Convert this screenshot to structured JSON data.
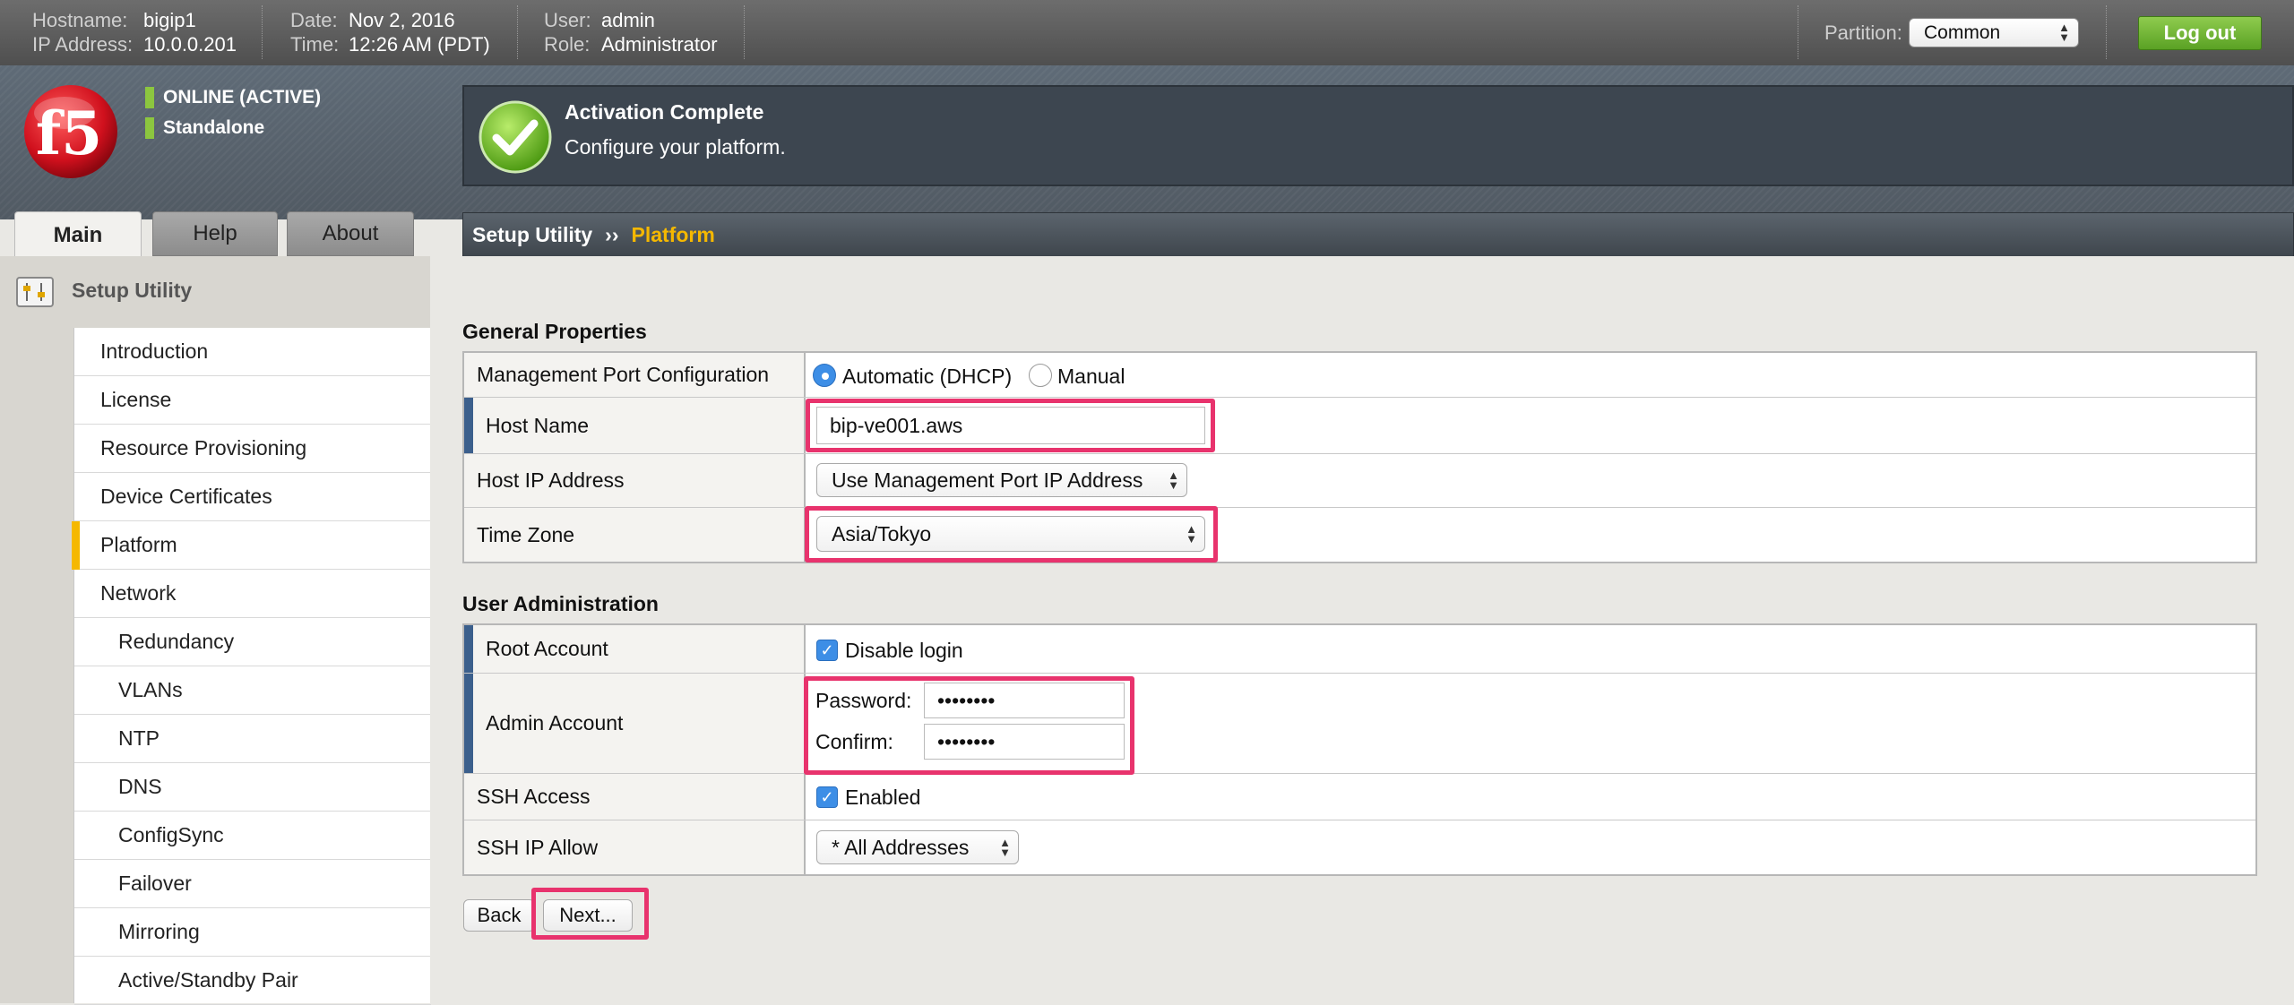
{
  "topbar": {
    "hostname_label": "Hostname:",
    "hostname": "bigip1",
    "ip_label": "IP Address:",
    "ip": "10.0.0.201",
    "date_label": "Date:",
    "date": "Nov 2, 2016",
    "time_label": "Time:",
    "time": "12:26 AM (PDT)",
    "user_label": "User:",
    "user": "admin",
    "role_label": "Role:",
    "role": "Administrator",
    "partition_label": "Partition:",
    "partition_value": "Common",
    "logout_label": "Log out"
  },
  "status": {
    "online": "ONLINE (ACTIVE)",
    "mode": "Standalone"
  },
  "activation": {
    "title": "Activation Complete",
    "subtitle": "Configure your platform."
  },
  "tabs": [
    {
      "label": "Main",
      "active": true
    },
    {
      "label": "Help",
      "active": false
    },
    {
      "label": "About",
      "active": false
    }
  ],
  "breadcrumb": {
    "root": "Setup Utility",
    "separator": "››",
    "current": "Platform"
  },
  "sidebar": {
    "title": "Setup Utility",
    "items": [
      {
        "label": "Introduction",
        "indent": false
      },
      {
        "label": "License",
        "indent": false
      },
      {
        "label": "Resource Provisioning",
        "indent": false
      },
      {
        "label": "Device Certificates",
        "indent": false
      },
      {
        "label": "Platform",
        "indent": false,
        "active": true
      },
      {
        "label": "Network",
        "indent": false
      },
      {
        "label": "Redundancy",
        "indent": true
      },
      {
        "label": "VLANs",
        "indent": true
      },
      {
        "label": "NTP",
        "indent": true
      },
      {
        "label": "DNS",
        "indent": true
      },
      {
        "label": "ConfigSync",
        "indent": true
      },
      {
        "label": "Failover",
        "indent": true
      },
      {
        "label": "Mirroring",
        "indent": true
      },
      {
        "label": "Active/Standby Pair",
        "indent": true
      }
    ]
  },
  "general": {
    "title": "General Properties",
    "mgmt_port_label": "Management Port Configuration",
    "mgmt_option_auto": "Automatic (DHCP)",
    "mgmt_option_manual": "Manual",
    "host_name_label": "Host Name",
    "host_name_value": "bip-ve001.aws",
    "host_ip_label": "Host IP Address",
    "host_ip_value": "Use Management Port IP Address",
    "timezone_label": "Time Zone",
    "timezone_value": "Asia/Tokyo"
  },
  "users": {
    "title": "User Administration",
    "root_label": "Root Account",
    "root_option": "Disable login",
    "admin_label": "Admin Account",
    "password_label": "Password:",
    "password_value": "••••••••",
    "confirm_label": "Confirm:",
    "confirm_value": "••••••••",
    "ssh_label": "SSH Access",
    "ssh_option": "Enabled",
    "ssh_allow_label": "SSH IP Allow",
    "ssh_allow_value": "* All Addresses"
  },
  "actions": {
    "back": "Back",
    "next": "Next..."
  },
  "colors": {
    "highlight": "#e8336d",
    "accent_yellow": "#f5b800",
    "status_green": "#8cc63f",
    "required_bar": "#3b5f8c"
  }
}
